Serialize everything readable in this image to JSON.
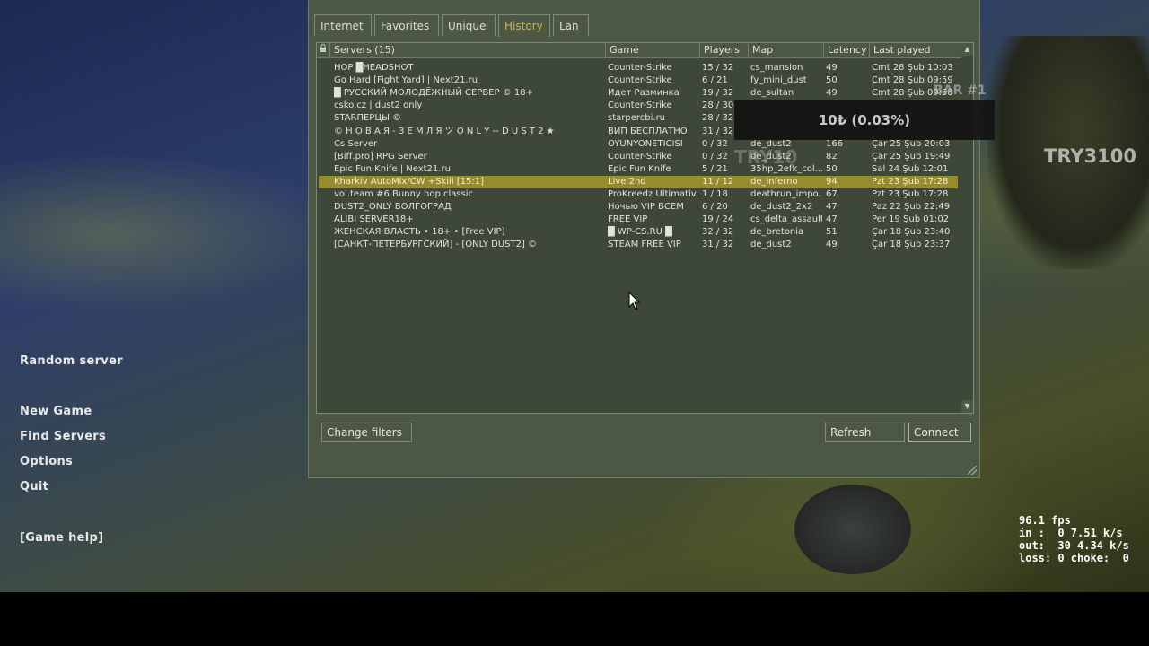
{
  "tabs": [
    "Internet",
    "Favorites",
    "Unique",
    "History",
    "Lan"
  ],
  "active_tab": "History",
  "columns": {
    "servers": "Servers (15)",
    "game": "Game",
    "players": "Players",
    "map": "Map",
    "latency": "Latency",
    "last_played": "Last played"
  },
  "rows": [
    {
      "name": "HOP █HEADSHOT",
      "game": "Counter-Strike",
      "players": "15 / 32",
      "map": "cs_mansion",
      "latency": "49",
      "last": "Cmt 28 Şub 10:03"
    },
    {
      "name": "Go Hard [Fight Yard] | Next21.ru",
      "game": "Counter-Strike",
      "players": "6 / 21",
      "map": "fy_mini_dust",
      "latency": "50",
      "last": "Cmt 28 Şub 09:59"
    },
    {
      "name": "█ РУССКИЙ МОЛОДЁЖНЫЙ СЕРВЕР © 18+",
      "game": "Идет Разминка",
      "players": "19 / 32",
      "map": "de_sultan",
      "latency": "49",
      "last": "Cmt 28 Şub 09:58"
    },
    {
      "name": "csko.cz | dust2 only",
      "game": "Counter-Strike",
      "players": "28 / 30",
      "map": "",
      "latency": "",
      "last": ""
    },
    {
      "name": "STARПЕРЦЫ ©",
      "game": "starpercbi.ru",
      "players": "28 / 32",
      "map": "",
      "latency": "",
      "last": ""
    },
    {
      "name": "© Н О В А Я - З Е М Л Я ツ O N L Y -- D U S T 2 ★",
      "game": "ВИП БЕСПЛАТНО",
      "players": "31 / 32",
      "map": "",
      "latency": "",
      "last": ""
    },
    {
      "name": "Cs Server",
      "game": "OYUNYONETICISI",
      "players": "0 / 32",
      "map": "de_dust2",
      "latency": "166",
      "last": "Çar 25 Şub 20:03"
    },
    {
      "name": "[Biff.pro] RPG Server",
      "game": "Counter-Strike",
      "players": "0 / 32",
      "map": "de_dust2",
      "latency": "82",
      "last": "Çar 25 Şub 19:49"
    },
    {
      "name": "Epic Fun Knife | Next21.ru",
      "game": "Epic Fun Knife",
      "players": "5 / 21",
      "map": "35hp_2efk_col...",
      "latency": "50",
      "last": "Sal 24 Şub 12:01"
    },
    {
      "name": "Kharkiv AutoMix/CW +Skill [15:1]",
      "game": "Live 2nd",
      "players": "11 / 12",
      "map": "de_inferno",
      "latency": "94",
      "last": "Pzt 23 Şub 17:28"
    },
    {
      "name": "vol.team #6 Bunny hop classic",
      "game": "ProKreedz Ultimativ...",
      "players": "1 / 18",
      "map": "deathrun_impo...",
      "latency": "67",
      "last": "Pzt 23 Şub 17:28"
    },
    {
      "name": "DUST2_ONLY ВОЛГОГРАД",
      "game": "Ночью VIP ВСЕМ",
      "players": "6 / 20",
      "map": "de_dust2_2x2",
      "latency": "47",
      "last": "Paz 22 Şub 22:49"
    },
    {
      "name": "ALIBI SERVER18+",
      "game": "FREE VIP",
      "players": "19 / 24",
      "map": "cs_delta_assault",
      "latency": "47",
      "last": "Per 19 Şub 01:02"
    },
    {
      "name": "ЖЕНСКАЯ ВЛАСТЬ • 18+ • [Free VIP]",
      "game": "█ WP-CS.RU █",
      "players": "32 / 32",
      "map": "de_bretonia",
      "latency": "51",
      "last": "Çar 18 Şub 23:40"
    },
    {
      "name": "[САНКТ-ПЕТЕРБУРГСКИЙ] - [ONLY DUST2] ©",
      "game": "STEAM FREE VIP",
      "players": "31 / 32",
      "map": "de_dust2",
      "latency": "49",
      "last": "Çar 18 Şub 23:37"
    }
  ],
  "selected_row": 9,
  "buttons": {
    "change_filters": "Change filters",
    "refresh": "Refresh",
    "connect": "Connect"
  },
  "main_menu": {
    "random_server": "Random server",
    "new_game": "New Game",
    "find_servers": "Find Servers",
    "options": "Options",
    "quit": "Quit",
    "game_help": "[Game help]"
  },
  "net_graph": {
    "fps": "96.1 fps",
    "in": "in :  0 7.51 k/s",
    "out": "out:  30 4.34 k/s",
    "loss": "loss: 0 choke:  0"
  },
  "overlay": {
    "tooltip": "10₺ (0.03%)",
    "bar_label": "BAR #1",
    "try10": "TRY10",
    "try3100": "TRY3100"
  },
  "colors": {
    "window_bg": "#4c5844",
    "list_bg": "#3e4838",
    "selected_row": "#958c2b",
    "active_tab_text": "#c6b651"
  }
}
